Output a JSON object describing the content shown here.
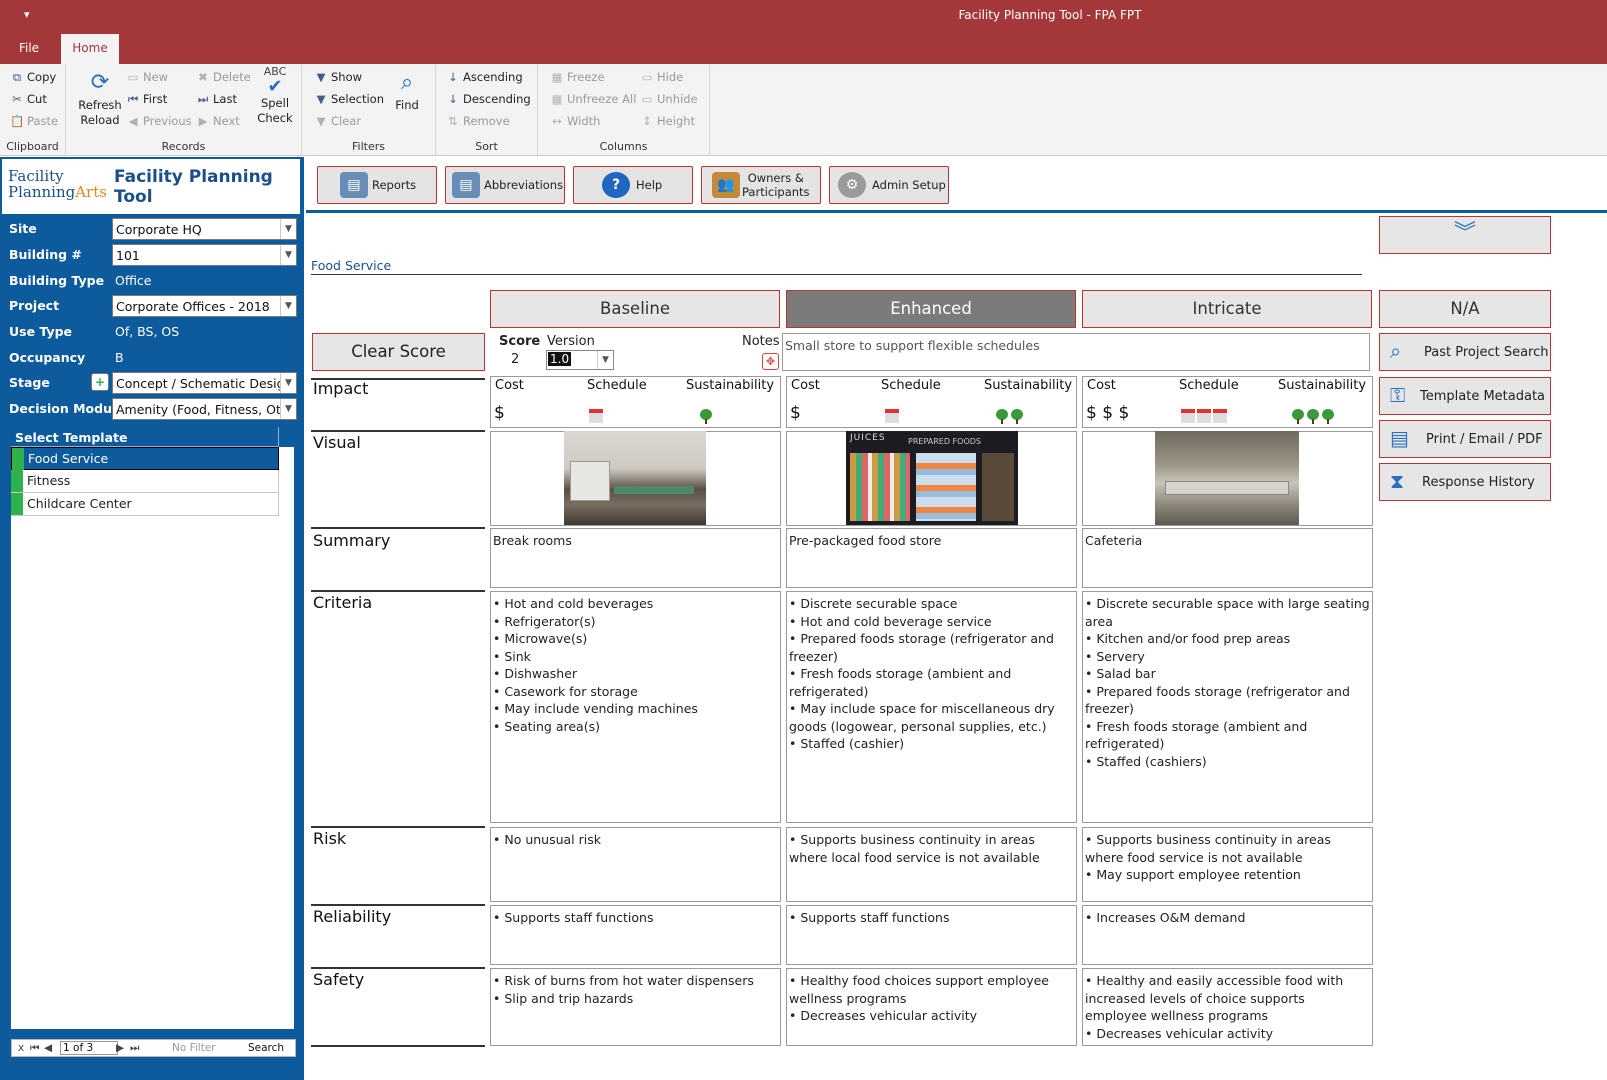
{
  "window": {
    "title": "Facility Planning Tool  -  FPA FPT",
    "qat_icon": "▾"
  },
  "menu": {
    "file": "File",
    "home": "Home"
  },
  "ribbon": {
    "clipboard": {
      "label": "Clipboard",
      "copy": "Copy",
      "cut": "Cut",
      "paste": "Paste"
    },
    "records": {
      "label": "Records",
      "refresh": "Refresh",
      "reload": "Reload",
      "new": "New",
      "delete": "Delete",
      "first": "First",
      "last": "Last",
      "previous": "Previous",
      "next": "Next",
      "spell": "Spell",
      "check": "Check",
      "abc": "ABC"
    },
    "filters": {
      "label": "Filters",
      "show": "Show",
      "selection": "Selection",
      "clear": "Clear",
      "find": "Find"
    },
    "sort": {
      "label": "Sort",
      "ascending": "Ascending",
      "descending": "Descending",
      "remove": "Remove"
    },
    "columns": {
      "label": "Columns",
      "freeze": "Freeze",
      "unfreeze_all": "Unfreeze All",
      "width": "Width",
      "hide": "Hide",
      "unhide": "Unhide",
      "height": "Height"
    }
  },
  "logo": {
    "line1": "Facility",
    "line2a": "Planning",
    "line2b": "Arts",
    "app_title": "Facility Planning Tool"
  },
  "toolbar": {
    "reports": "Reports",
    "abbreviations": "Abbreviations",
    "help": "Help",
    "owners_1": "Owners &",
    "owners_2": "Participants",
    "admin": "Admin Setup"
  },
  "filters_panel": {
    "site_label": "Site",
    "site_value": "Corporate HQ",
    "building_label": "Building #",
    "building_value": "101",
    "building_type_label": "Building Type",
    "building_type_value": "Office",
    "project_label": "Project",
    "project_value": "Corporate Offices - 2018",
    "use_type_label": "Use Type",
    "use_type_value": "Of, BS, OS",
    "occupancy_label": "Occupancy",
    "occupancy_value": "B",
    "stage_label": "Stage",
    "stage_value": "Concept / Schematic Design",
    "decision_label": "Decision Module",
    "decision_value": "Amenity (Food, Fitness, Other)"
  },
  "templates": {
    "header": "Select Template",
    "items": [
      "Food Service",
      "Fitness",
      "Childcare Center"
    ]
  },
  "record_nav": {
    "position": "1 of 3",
    "filter": "No Filter",
    "search": "Search"
  },
  "section_title": "Food Service",
  "options": {
    "baseline": "Baseline",
    "enhanced": "Enhanced",
    "intricate": "Intricate",
    "na": "N/A"
  },
  "score": {
    "clear_label": "Clear Score",
    "score_label": "Score",
    "score_value": "2",
    "version_label": "Version",
    "version_value": "1.0",
    "notes_label": "Notes",
    "notes_value": "Small store to support flexible schedules"
  },
  "row_labels": {
    "impact": "Impact",
    "visual": "Visual",
    "summary": "Summary",
    "criteria": "Criteria",
    "risk": "Risk",
    "reliability": "Reliability",
    "safety": "Safety"
  },
  "impact_headers": {
    "cost": "Cost",
    "schedule": "Schedule",
    "sustainability": "Sustainability"
  },
  "impact": {
    "baseline": {
      "cost": "$",
      "schedule_count": 1,
      "sustain_count": 1
    },
    "enhanced": {
      "cost": "$",
      "schedule_count": 1,
      "sustain_count": 2
    },
    "intricate": {
      "cost": "$ $ $",
      "schedule_count": 3,
      "sustain_count": 3
    }
  },
  "summary": {
    "baseline": "Break rooms",
    "enhanced": "Pre-packaged food store",
    "intricate": "Cafeteria"
  },
  "image_text": {
    "juices": "JUICES",
    "prepared": "PREPARED FOODS"
  },
  "criteria": {
    "baseline": [
      "Hot and cold beverages",
      "Refrigerator(s)",
      "Microwave(s)",
      "Sink",
      "Dishwasher",
      "Casework for storage",
      "May include vending machines",
      "Seating area(s)"
    ],
    "enhanced": [
      "Discrete securable space",
      "Hot and cold beverage service",
      "Prepared foods storage (refrigerator and freezer)",
      "Fresh foods storage (ambient and refrigerated)",
      "May include space for miscellaneous dry goods (logowear, personal supplies, etc.)",
      "Staffed (cashier)"
    ],
    "intricate": [
      "Discrete securable space with large seating area",
      "Kitchen and/or food prep areas",
      "Servery",
      "Salad bar",
      "Prepared foods storage (refrigerator and freezer)",
      "Fresh foods storage (ambient and refrigerated)",
      "Staffed (cashiers)"
    ]
  },
  "risk": {
    "baseline": [
      "No unusual risk"
    ],
    "enhanced": [
      "Supports business continuity in areas where local food service is not available"
    ],
    "intricate": [
      "Supports business continuity in areas where food service is not available",
      "May support employee retention"
    ]
  },
  "reliability": {
    "baseline": [
      "Supports staff functions"
    ],
    "enhanced": [
      "Supports staff functions"
    ],
    "intricate": [
      "Increases O&M demand"
    ]
  },
  "safety": {
    "baseline": [
      "Risk of burns from hot water dispensers",
      "Slip and trip hazards"
    ],
    "enhanced": [
      "Healthy food choices support employee wellness programs",
      "Decreases vehicular activity"
    ],
    "intricate": [
      "Healthy and easily accessible food with increased levels of choice supports employee wellness programs",
      "Decreases vehicular activity"
    ]
  },
  "side_buttons": {
    "past_project": "Past Project Search",
    "metadata": "Template Metadata",
    "print": "Print / Email / PDF",
    "history": "Response History"
  },
  "colors": {
    "title_bar": "#a4373a",
    "panel_blue": "#0d5a9c",
    "button_border": "#b33333",
    "selected_option": "#7b7b7b",
    "template_bar": "#2fb14b"
  }
}
